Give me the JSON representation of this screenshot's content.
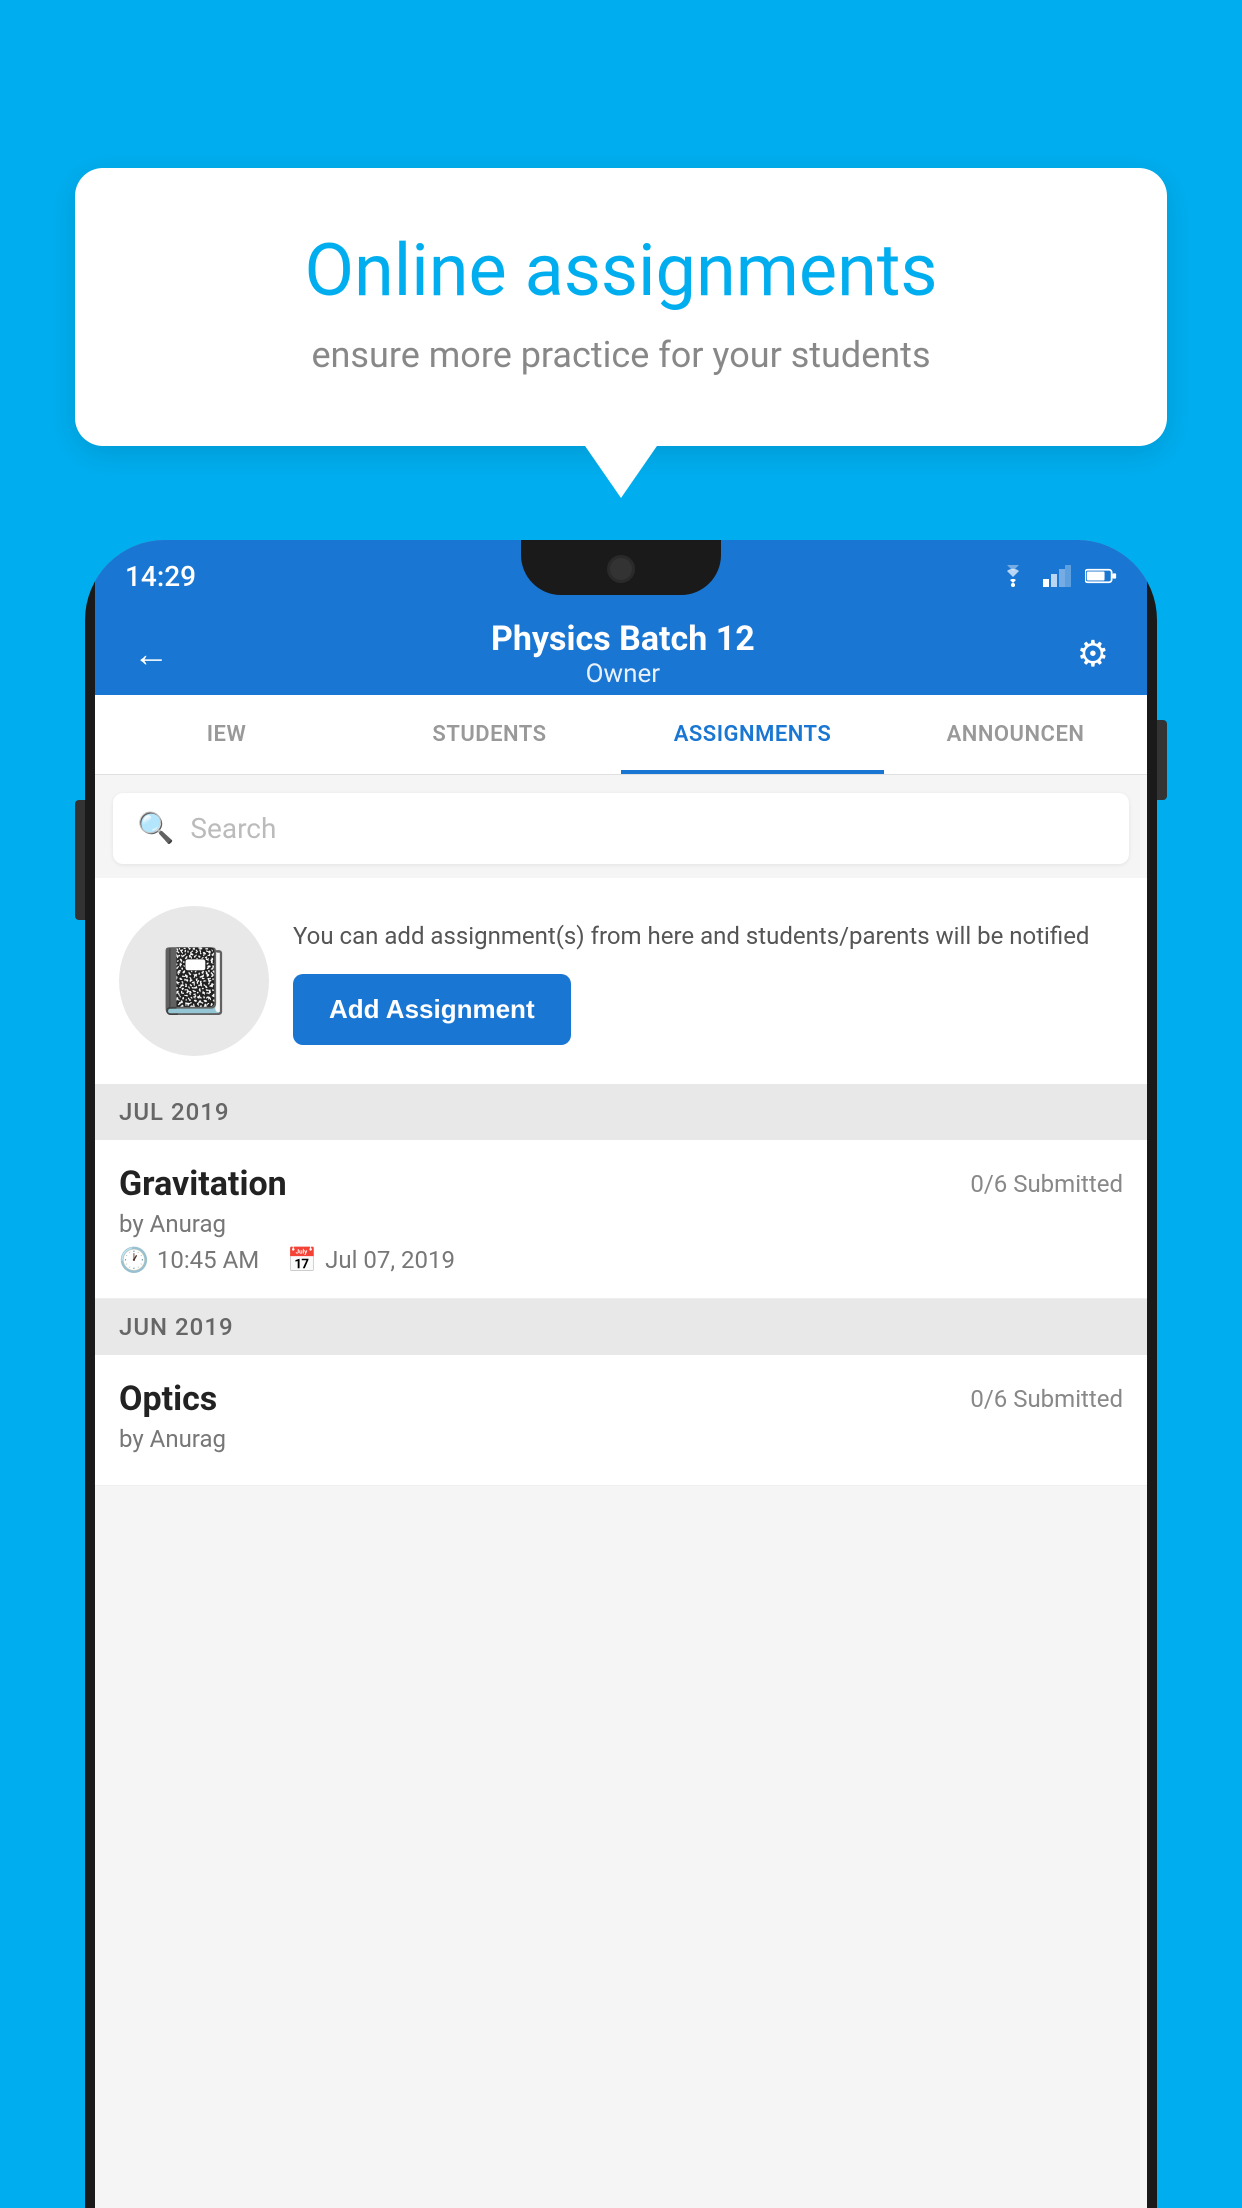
{
  "background_color": "#00AEEF",
  "bubble": {
    "title": "Online assignments",
    "subtitle": "ensure more practice for your students"
  },
  "phone": {
    "status_bar": {
      "time": "14:29"
    },
    "header": {
      "title": "Physics Batch 12",
      "subtitle": "Owner",
      "back_label": "←",
      "settings_label": "⚙"
    },
    "tabs": [
      {
        "label": "IEW",
        "active": false
      },
      {
        "label": "STUDENTS",
        "active": false
      },
      {
        "label": "ASSIGNMENTS",
        "active": true
      },
      {
        "label": "ANNOUNCEM...",
        "active": false
      }
    ],
    "search": {
      "placeholder": "Search"
    },
    "promo": {
      "text": "You can add assignment(s) from here and students/parents will be notified",
      "button_label": "Add Assignment"
    },
    "sections": [
      {
        "month_label": "JUL 2019",
        "assignments": [
          {
            "name": "Gravitation",
            "submitted": "0/6 Submitted",
            "by": "by Anurag",
            "time": "10:45 AM",
            "date": "Jul 07, 2019"
          }
        ]
      },
      {
        "month_label": "JUN 2019",
        "assignments": [
          {
            "name": "Optics",
            "submitted": "0/6 Submitted",
            "by": "by Anurag",
            "time": "",
            "date": ""
          }
        ]
      }
    ]
  }
}
